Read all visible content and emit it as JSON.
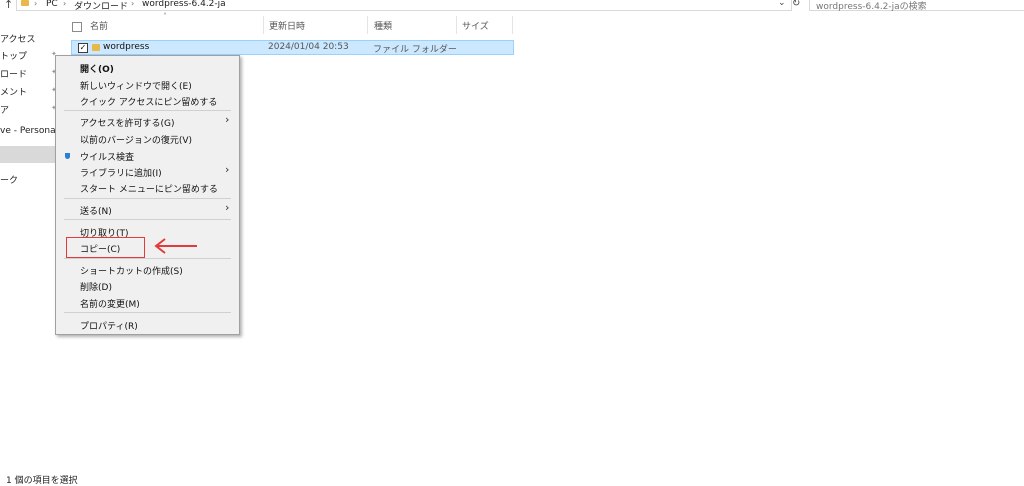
{
  "breadcrumb": {
    "items": [
      "PC",
      "ダウンロード",
      "wordpress-6.4.2-ja"
    ]
  },
  "search": {
    "placeholder": "wordpress-6.4.2-jaの検索"
  },
  "nav": {
    "items": [
      "アクセス",
      "トップ",
      "ロード",
      "メント",
      "ア",
      "ve - Personal",
      "ーク"
    ]
  },
  "columns": {
    "name": "名前",
    "modified": "更新日時",
    "type": "種類",
    "size": "サイズ"
  },
  "rows": [
    {
      "name": "wordpress",
      "modified": "2024/01/04 20:53",
      "type": "ファイル フォルダー"
    }
  ],
  "context_menu": {
    "open": "開く(O)",
    "open_new_window": "新しいウィンドウで開く(E)",
    "pin_quick_access": "クイック アクセスにピン留めする",
    "give_access": "アクセスを許可する(G)",
    "restore_versions": "以前のバージョンの復元(V)",
    "virus_scan": "ウイルス検査",
    "add_library": "ライブラリに追加(I)",
    "pin_start": "スタート メニューにピン留めする",
    "send_to": "送る(N)",
    "cut": "切り取り(T)",
    "copy": "コピー(C)",
    "create_shortcut": "ショートカットの作成(S)",
    "delete": "削除(D)",
    "rename": "名前の変更(M)",
    "properties": "プロパティ(R)"
  },
  "annotation_color": "#e33b3b",
  "status": "1 個の項目を選択"
}
